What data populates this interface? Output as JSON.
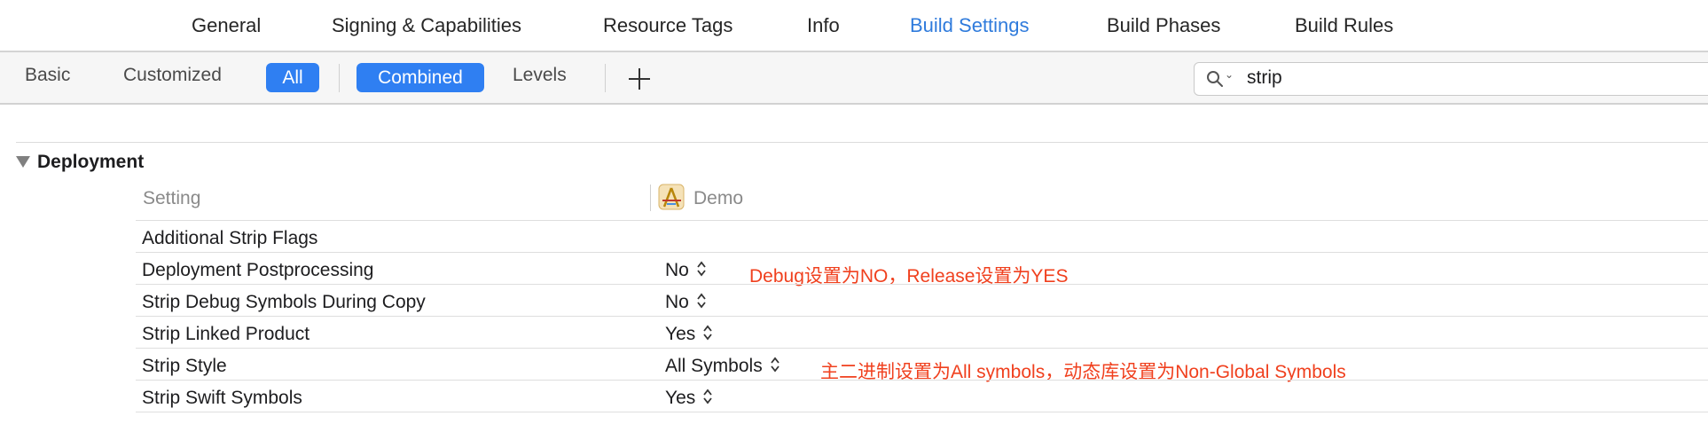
{
  "top_tabs": [
    "General",
    "Signing & Capabilities",
    "Resource Tags",
    "Info",
    "Build Settings",
    "Build Phases",
    "Build Rules"
  ],
  "filter_bar": {
    "basic": "Basic",
    "customized": "Customized",
    "all": "All",
    "combined": "Combined",
    "levels": "Levels"
  },
  "search": {
    "value": "strip"
  },
  "section": {
    "title": "Deployment"
  },
  "columns": {
    "setting": "Setting",
    "target": "Demo"
  },
  "rows": [
    {
      "label": "Additional Strip Flags",
      "value": ""
    },
    {
      "label": "Deployment Postprocessing",
      "value": "No"
    },
    {
      "label": "Strip Debug Symbols During Copy",
      "value": "No"
    },
    {
      "label": "Strip Linked Product",
      "value": "Yes"
    },
    {
      "label": "Strip Style",
      "value": "All Symbols"
    },
    {
      "label": "Strip Swift Symbols",
      "value": "Yes"
    }
  ],
  "annotations": {
    "postprocessing": "Debug设置为NO，Release设置为YES",
    "strip_style": "主二进制设置为All symbols，动态库设置为Non-Global Symbols"
  },
  "colors": {
    "accent": "#2f7ff2",
    "active_tab": "#2f7bdc",
    "annotation": "#f0401e"
  }
}
